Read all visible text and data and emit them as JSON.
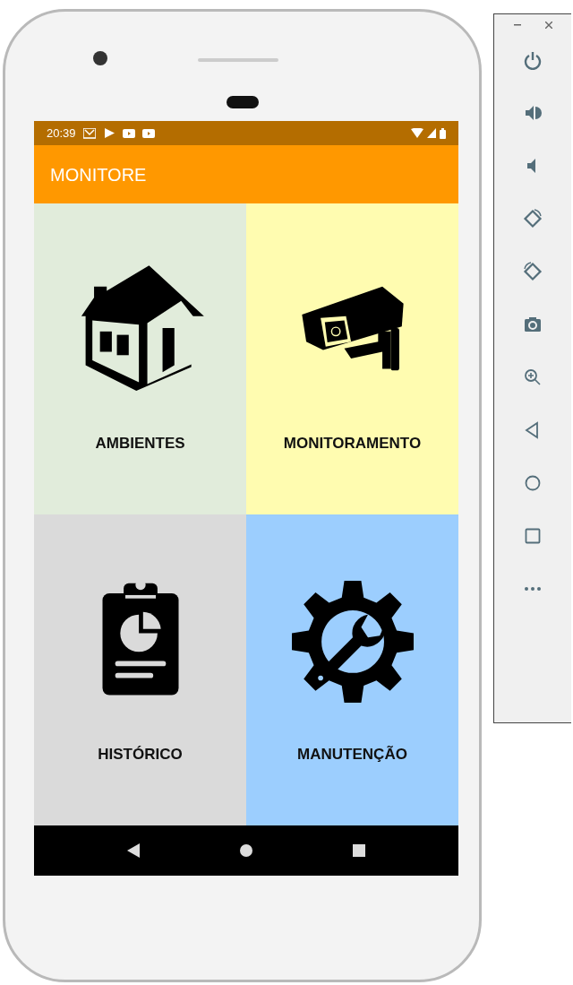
{
  "status_bar": {
    "time": "20:39",
    "notifications": [
      {
        "kind": "mail"
      },
      {
        "kind": "play"
      },
      {
        "kind": "video"
      },
      {
        "kind": "video"
      }
    ]
  },
  "app_bar": {
    "title": "MONITORE"
  },
  "tiles": [
    {
      "label": "AMBIENTES",
      "kind": "house",
      "color": "#e1ecdb"
    },
    {
      "label": "MONITORAMENTO",
      "kind": "camera",
      "color": "#fffcb0"
    },
    {
      "label": "HISTÓRICO",
      "kind": "clipboard",
      "color": "#dadada"
    },
    {
      "label": "MANUTENÇÃO",
      "kind": "gear",
      "color": "#9ccefe"
    }
  ],
  "emulator_toolbar": {
    "buttons": [
      {
        "kind": "power"
      },
      {
        "kind": "volume-up"
      },
      {
        "kind": "volume-down"
      },
      {
        "kind": "rotate-left"
      },
      {
        "kind": "rotate-right"
      },
      {
        "kind": "screenshot"
      },
      {
        "kind": "zoom"
      },
      {
        "kind": "back"
      },
      {
        "kind": "home"
      },
      {
        "kind": "overview"
      },
      {
        "kind": "more"
      }
    ]
  }
}
